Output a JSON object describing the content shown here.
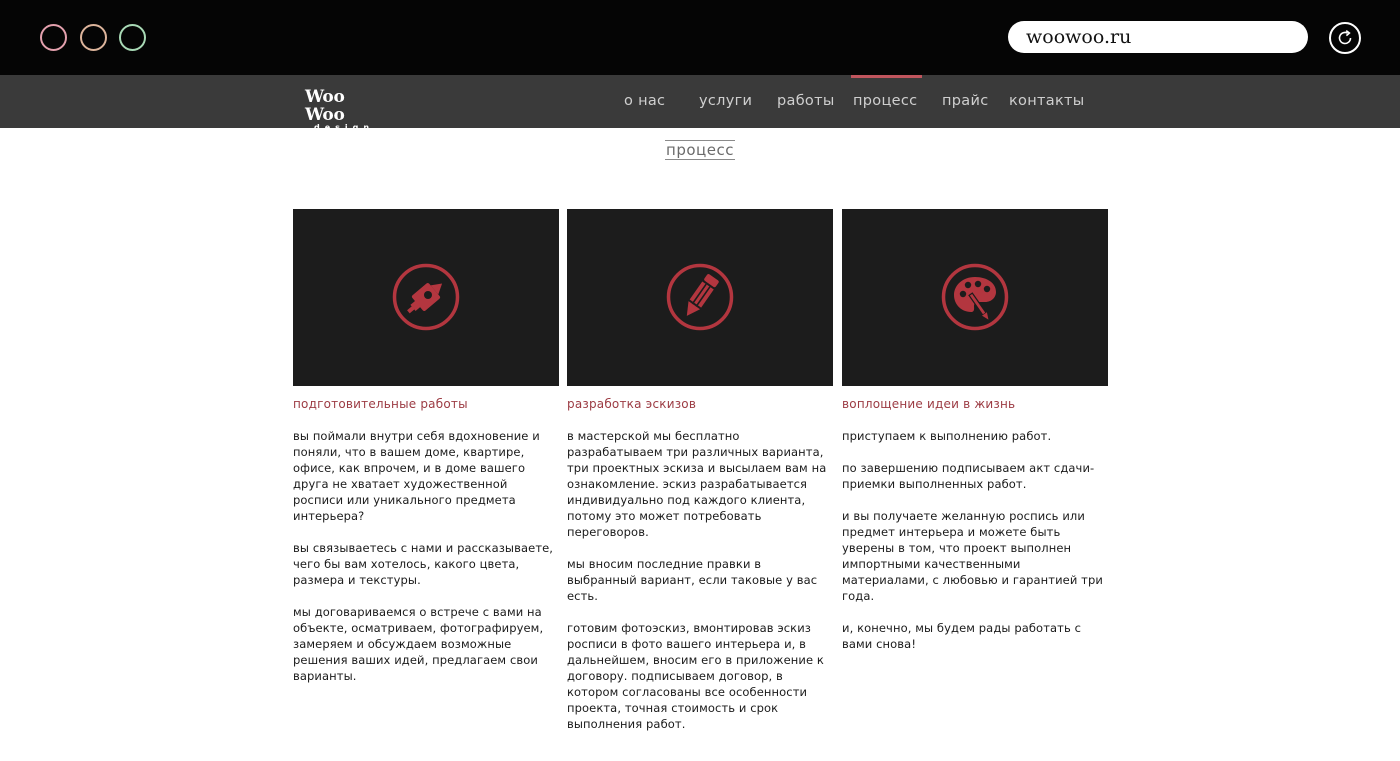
{
  "browser": {
    "url": "woowoo.ru",
    "window_buttons": [
      {
        "name": "close",
        "color": "#e3a0ad"
      },
      {
        "name": "minimize",
        "color": "#dcb49b"
      },
      {
        "name": "maximize",
        "color": "#a8d9b5"
      }
    ],
    "reload_icon": "reload-icon"
  },
  "header": {
    "logo_main": "Woo Woo",
    "logo_sub": "design",
    "nav": [
      {
        "label": "о нас"
      },
      {
        "label": "услуги"
      },
      {
        "label": "работы"
      },
      {
        "label": "процесс",
        "active": true
      },
      {
        "label": "прайс"
      },
      {
        "label": "контакты"
      }
    ],
    "accent_color": "#c0555d"
  },
  "page": {
    "title": "процесс"
  },
  "columns": [
    {
      "icon": "pencil-sharpener-icon",
      "heading": "подготовительные работы",
      "paragraphs": [
        "вы поймали внутри себя вдохновение и поняли, что в вашем доме, квартире, офисе, как впрочем, и в доме вашего друга не хватает художественной росписи или уникального предмета интерьера?",
        "вы связываетесь с нами и рассказываете, чего бы вам хотелось, какого цвета, размера и текстуры.",
        "мы договариваемся о встрече с вами на объекте, осматриваем, фотографируем, замеряем и обсуждаем возможные решения ваших идей, предлагаем свои варианты."
      ]
    },
    {
      "icon": "pencil-icon",
      "heading": "разработка эскизов",
      "paragraphs": [
        "в мастерской мы бесплатно разрабатываем три различных варианта, три проектных эскиза и высылаем вам на ознакомление. эскиз разрабатывается индивидуально под каждого клиента, потому это может потребовать переговоров.",
        "мы вносим последние правки в выбранный вариант, если таковые у вас есть.",
        "готовим фотоэскиз, вмонтировав эскиз росписи в фото вашего интерьера и, в дальнейшем, вносим его в приложение к договору. подписываем договор, в котором согласованы все особенности проекта, точная стоимость и срок выполнения работ."
      ]
    },
    {
      "icon": "palette-icon",
      "heading": "воплощение идеи в жизнь",
      "paragraphs": [
        "приступаем к выполнению работ.",
        "по завершению подписываем акт сдачи-приемки выполненных работ.",
        "и вы получаете желанную роспись или предмет интерьера и можете быть уверены в том, что проект выполнен импортными качественными материалами, с любовью и гарантией три года.",
        "и, конечно, мы будем рады работать с вами снова!"
      ]
    }
  ]
}
